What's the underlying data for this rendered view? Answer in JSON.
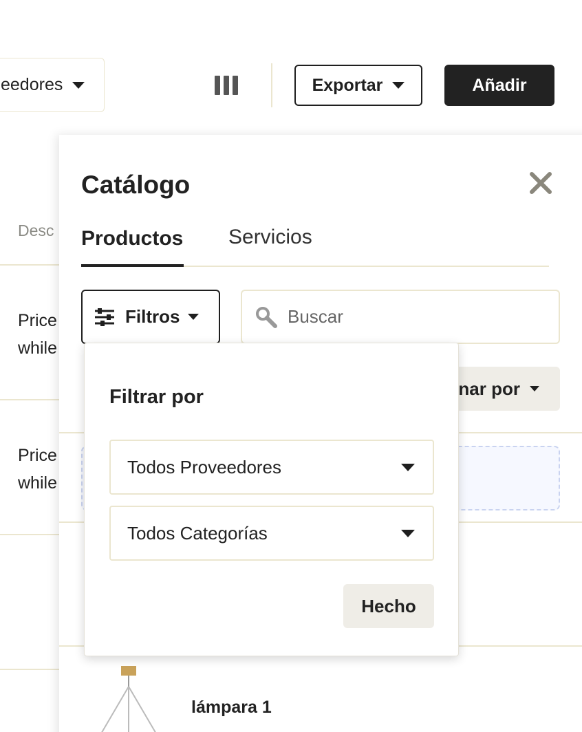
{
  "toolbar": {
    "supplier_select_value": "eedores",
    "export_label": "Exportar",
    "add_label": "Añadir"
  },
  "background_table": {
    "column_header": "Desc",
    "rows": [
      {
        "line1": "Price",
        "line2": "while"
      },
      {
        "line1": "Price",
        "line2": "while"
      }
    ]
  },
  "catalog": {
    "title": "Catálogo",
    "tabs": [
      {
        "label": "Productos",
        "active": true
      },
      {
        "label": "Servicios",
        "active": false
      }
    ],
    "filters_label": "Filtros",
    "search_placeholder": "Buscar",
    "sort_label": "nar por",
    "products": [
      {
        "name": "lámpara 1"
      }
    ]
  },
  "filter_popover": {
    "title": "Filtrar por",
    "supplier_select": "Todos Proveedores",
    "category_select": "Todos Categorías",
    "done_label": "Hecho"
  },
  "colors": {
    "primary_button": "#222222",
    "border_light": "#ebe6cf",
    "secondary_button": "#efede7",
    "dropzone_bg": "#f6f8ff"
  }
}
